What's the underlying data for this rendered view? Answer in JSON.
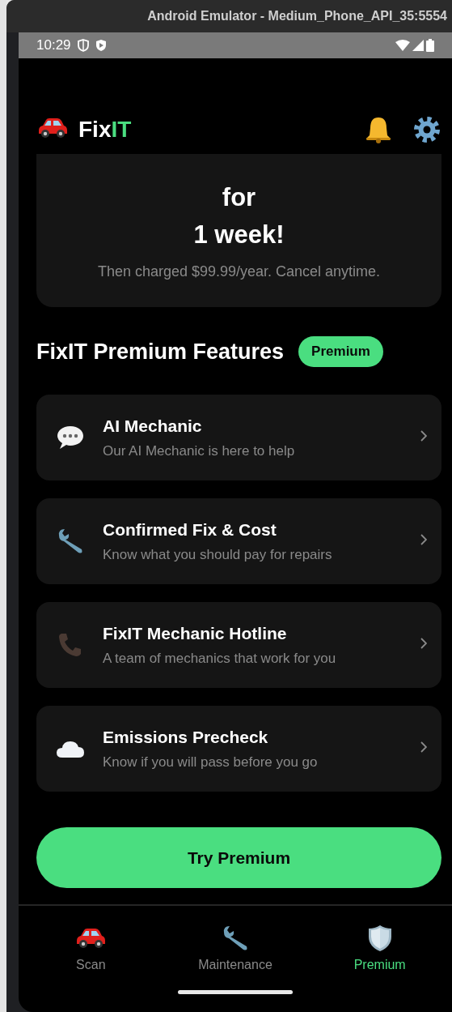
{
  "window": {
    "title": "Android Emulator - Medium_Phone_API_35:5554"
  },
  "status_bar": {
    "time": "10:29"
  },
  "header": {
    "brand_first": "Fix",
    "brand_second": "IT"
  },
  "promo": {
    "lines": [
      "for",
      "1 week!"
    ],
    "note": "Then charged $99.99/year. Cancel anytime."
  },
  "features_section": {
    "title": "FixIT Premium Features",
    "badge": "Premium"
  },
  "features": [
    {
      "kind": "chat",
      "title": "AI Mechanic",
      "subtitle": "Our AI Mechanic is here to help"
    },
    {
      "kind": "wrench",
      "title": "Confirmed Fix & Cost",
      "subtitle": "Know what you should pay for repairs"
    },
    {
      "kind": "phone",
      "title": "FixIT Mechanic Hotline",
      "subtitle": "A team of mechanics that work for you"
    },
    {
      "kind": "cloud",
      "title": "Emissions Precheck",
      "subtitle": "Know if you will pass before you go"
    }
  ],
  "cta": {
    "label": "Try Premium"
  },
  "nav": [
    {
      "kind": "car",
      "label": "Scan",
      "selected": false
    },
    {
      "kind": "wrench",
      "label": "Maintenance",
      "selected": false
    },
    {
      "kind": "shield",
      "label": "Premium",
      "selected": true
    }
  ]
}
